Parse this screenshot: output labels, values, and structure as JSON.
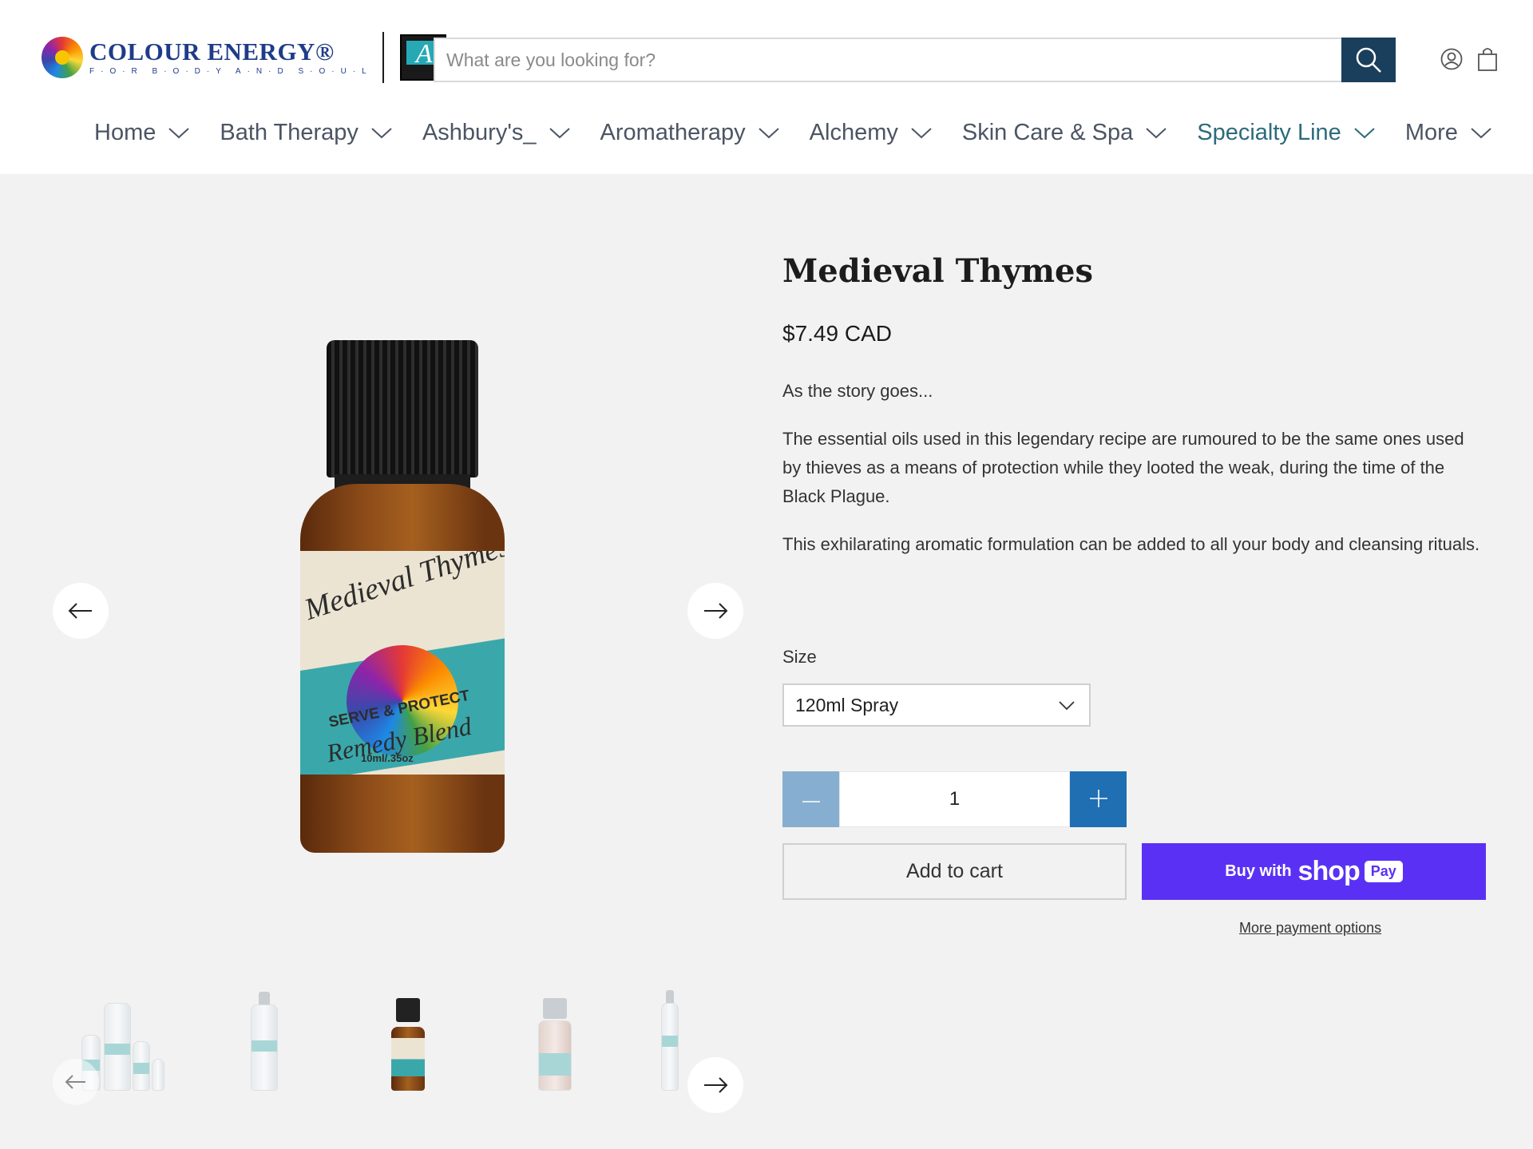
{
  "header": {
    "logo_name": "COLOUR ENERGY®",
    "logo_tagline": "F·O·R B·O·D·Y A·N·D S·O·U·L",
    "logo_badge_letter": "A",
    "search_placeholder": "What are you looking for?",
    "icons": {
      "search": "search-icon",
      "account": "account-icon",
      "cart": "cart-icon"
    }
  },
  "nav": {
    "items": [
      {
        "label": "Home"
      },
      {
        "label": "Bath Therapy"
      },
      {
        "label": "Ashbury's_"
      },
      {
        "label": "Aromatherapy"
      },
      {
        "label": "Alchemy"
      },
      {
        "label": "Skin Care & Spa"
      },
      {
        "label": "Specialty Line",
        "active": true
      },
      {
        "label": "More"
      }
    ]
  },
  "gallery": {
    "label_title": "Medieval Thymes",
    "label_line1": "SERVE & PROTECT",
    "label_line2": "Remedy Blend",
    "label_size": "10ml/.35oz",
    "thumbnail_count": 5
  },
  "product": {
    "title": "Medieval Thymes",
    "price": "$7.49 CAD",
    "description": [
      "As the story goes...",
      "The essential oils used in this legendary recipe are rumoured to be the same ones used by thieves as a means of protection while they looted the weak, during the time of the Black Plague.",
      "This exhilarating  aromatic formulation can be added to all your body and cleansing rituals."
    ],
    "size_label": "Size",
    "size_selected": "120ml Spray",
    "quantity": "1",
    "add_to_cart": "Add to cart",
    "buy_with": "Buy with",
    "shop_word": "shop",
    "pay_word": "Pay",
    "more_payment": "More payment options"
  },
  "colors": {
    "header_bg": "#ffffff",
    "page_bg": "#f2f2f2",
    "search_button": "#1a3f5c",
    "nav_active": "#2c6b7a",
    "qty_minus": "#86aed0",
    "qty_plus": "#1f6fb2",
    "shop_pay": "#5a31f4"
  }
}
